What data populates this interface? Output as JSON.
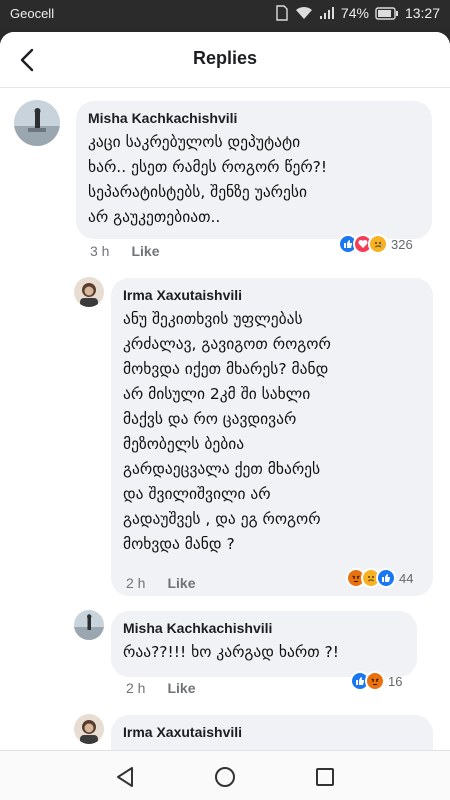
{
  "status_bar": {
    "carrier": "Geocell",
    "battery": "74%",
    "time": "13:27"
  },
  "header": {
    "title": "Replies"
  },
  "comments": [
    {
      "author": "Misha Kachkachishvili",
      "text": "კაცი საკრებულოს დეპუტატი\nხარ.. ესეთ რამეს როგორ წერ?!\nსეპარატისტებს, შენზე უარესი\nარ გაუკეთებიათ..",
      "time": "3 h",
      "like_label": "Like",
      "reaction_count": "326",
      "reactions": [
        "like-icon",
        "love-icon",
        "sad-icon"
      ]
    },
    {
      "author": "Irma Xaxutaishvili",
      "text": "ანუ შეკითხვის უფლებას\nკრძალავ, გავიგოთ როგორ\nმოხვდა იქეთ მხარეს? მანდ\nარ მისული 2კმ ში სახლი\nმაქვს და რო ცავდივარ\nმეზობელს ბებია\nგარდაეცვალა ქეთ მხარეს\nდა შვილიშვილი არ\nგადაუშვეს , და ეგ როგორ\nმოხვდა მანდ ?",
      "time": "2 h",
      "like_label": "Like",
      "reaction_count": "44",
      "reactions": [
        "angry-icon",
        "sad-icon",
        "like-icon"
      ]
    },
    {
      "author": "Misha Kachkachishvili",
      "text": "რაა??!!! ხო კარგად ხართ ?!",
      "time": "2 h",
      "like_label": "Like",
      "reaction_count": "16",
      "reactions": [
        "like-icon",
        "angry-icon"
      ]
    },
    {
      "author": "Irma Xaxutaishvili"
    }
  ],
  "colors": {
    "like": "#1877f2",
    "love": "#f33e58",
    "sad": "#f7b125",
    "angry": "#e9710f",
    "bubble": "#f0f2f5"
  }
}
